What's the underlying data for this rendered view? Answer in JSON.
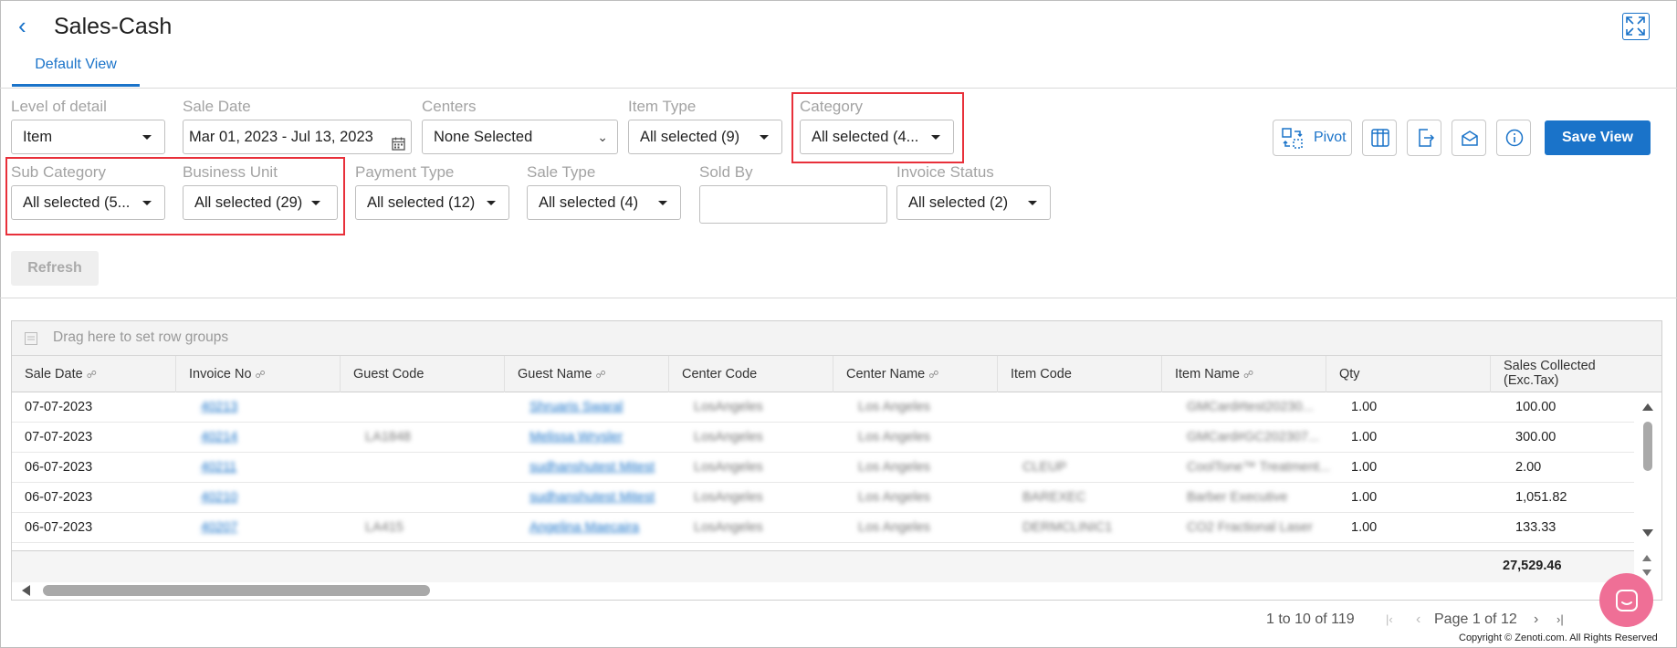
{
  "header": {
    "title": "Sales-Cash"
  },
  "tabs": [
    {
      "label": "Default View"
    }
  ],
  "filters": {
    "level_of_detail": {
      "label": "Level of detail",
      "value": "Item"
    },
    "sale_date": {
      "label": "Sale Date",
      "value": "Mar 01, 2023 - Jul 13, 2023"
    },
    "centers": {
      "label": "Centers",
      "value": "None Selected"
    },
    "item_type": {
      "label": "Item Type",
      "value": "All selected (9)"
    },
    "category": {
      "label": "Category",
      "value": "All selected (4..."
    },
    "sub_category": {
      "label": "Sub Category",
      "value": "All selected (5..."
    },
    "business_unit": {
      "label": "Business Unit",
      "value": "All selected (29)"
    },
    "payment_type": {
      "label": "Payment Type",
      "value": "All selected (12)"
    },
    "sale_type": {
      "label": "Sale Type",
      "value": "All selected (4)"
    },
    "sold_by": {
      "label": "Sold By",
      "value": ""
    },
    "invoice_status": {
      "label": "Invoice Status",
      "value": "All selected (2)"
    }
  },
  "buttons": {
    "refresh": "Refresh",
    "pivot": "Pivot",
    "save_view": "Save View"
  },
  "grid": {
    "row_group_hint": "Drag here to set row groups",
    "columns": [
      "Sale Date",
      "Invoice No",
      "Guest Code",
      "Guest Name",
      "Center Code",
      "Center Name",
      "Item Code",
      "Item Name",
      "Qty",
      "Sales Collected",
      "(Exc.Tax)"
    ],
    "rows": [
      {
        "sale_date": "07-07-2023",
        "invoice_no": "40213",
        "guest_code": "",
        "guest_name": "Shruaris Swaral",
        "center_code": "LosAngeles",
        "center_name": "Los Angeles",
        "item_code": "",
        "item_name": "GMCard#test20230...",
        "qty": "1.00",
        "sales": "100.00"
      },
      {
        "sale_date": "07-07-2023",
        "invoice_no": "40214",
        "guest_code": "LA1848",
        "guest_name": "Melissa Wrysler",
        "center_code": "LosAngeles",
        "center_name": "Los Angeles",
        "item_code": "",
        "item_name": "GMCard#GC202307...",
        "qty": "1.00",
        "sales": "300.00"
      },
      {
        "sale_date": "06-07-2023",
        "invoice_no": "40211",
        "guest_code": "",
        "guest_name": "sudhanshutest Mitest",
        "center_code": "LosAngeles",
        "center_name": "Los Angeles",
        "item_code": "CLEUP",
        "item_name": "CoolTone™ Treatment...",
        "qty": "1.00",
        "sales": "2.00"
      },
      {
        "sale_date": "06-07-2023",
        "invoice_no": "40210",
        "guest_code": "",
        "guest_name": "sudhanshutest Mitest",
        "center_code": "LosAngeles",
        "center_name": "Los Angeles",
        "item_code": "BAREXEC",
        "item_name": "Barber Executive",
        "qty": "1.00",
        "sales": "1,051.82"
      },
      {
        "sale_date": "06-07-2023",
        "invoice_no": "40207",
        "guest_code": "LA415",
        "guest_name": "Angelina Maecaira",
        "center_code": "LosAngeles",
        "center_name": "Los Angeles",
        "item_code": "DERMCLINIC1",
        "item_name": "CO2 Fractional Laser",
        "qty": "1.00",
        "sales": "133.33"
      }
    ],
    "total": "27,529.46"
  },
  "pagination": {
    "range": "1 to 10 of 119",
    "page": "Page 1 of 12"
  },
  "footer": {
    "copyright": "Copyright © Zenoti.com. All Rights Reserved"
  },
  "colors": {
    "accent": "#1a73c9",
    "highlight": "#e8303a",
    "chat": "#ef6f96"
  }
}
